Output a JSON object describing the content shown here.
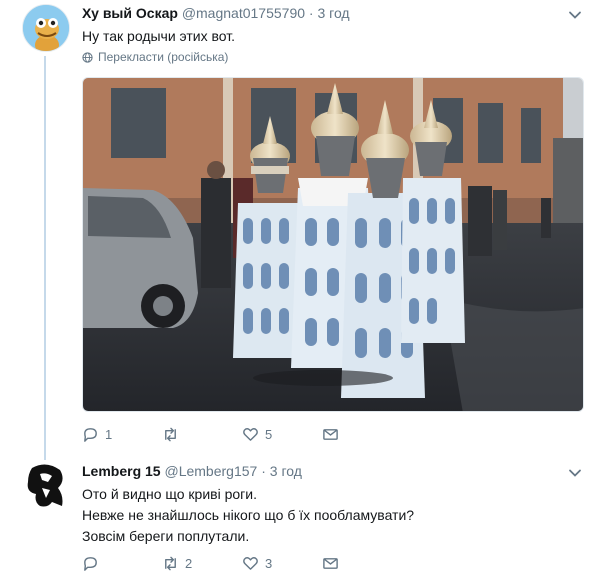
{
  "tweets": [
    {
      "name": "Ху  вый Оскар",
      "handle": "@magnat01755790",
      "separator": "·",
      "time": "3 год",
      "text_lines": [
        "Ну так родычи этих вот."
      ],
      "translate_label": "Перекласти (російська)",
      "replies": "1",
      "retweets": "",
      "likes": "5"
    },
    {
      "name": "Lemberg 15",
      "handle": "@Lemberg157",
      "separator": "·",
      "time": "3 год",
      "text_lines": [
        "Ото й видно що криві роги.",
        "Невже не знайшлось нікого що б їх пообламувати?",
        "Зовсім береги поплутали."
      ],
      "replies": "",
      "retweets": "2",
      "likes": "3"
    }
  ],
  "icons": {
    "reply": "reply-icon",
    "retweet": "retweet-icon",
    "like": "heart-icon",
    "dm": "envelope-icon",
    "more": "chevron-down-icon",
    "translate": "globe-icon"
  },
  "colors": {
    "text": "#14171a",
    "secondary": "#657786",
    "thread_line": "#c5d9ea"
  }
}
